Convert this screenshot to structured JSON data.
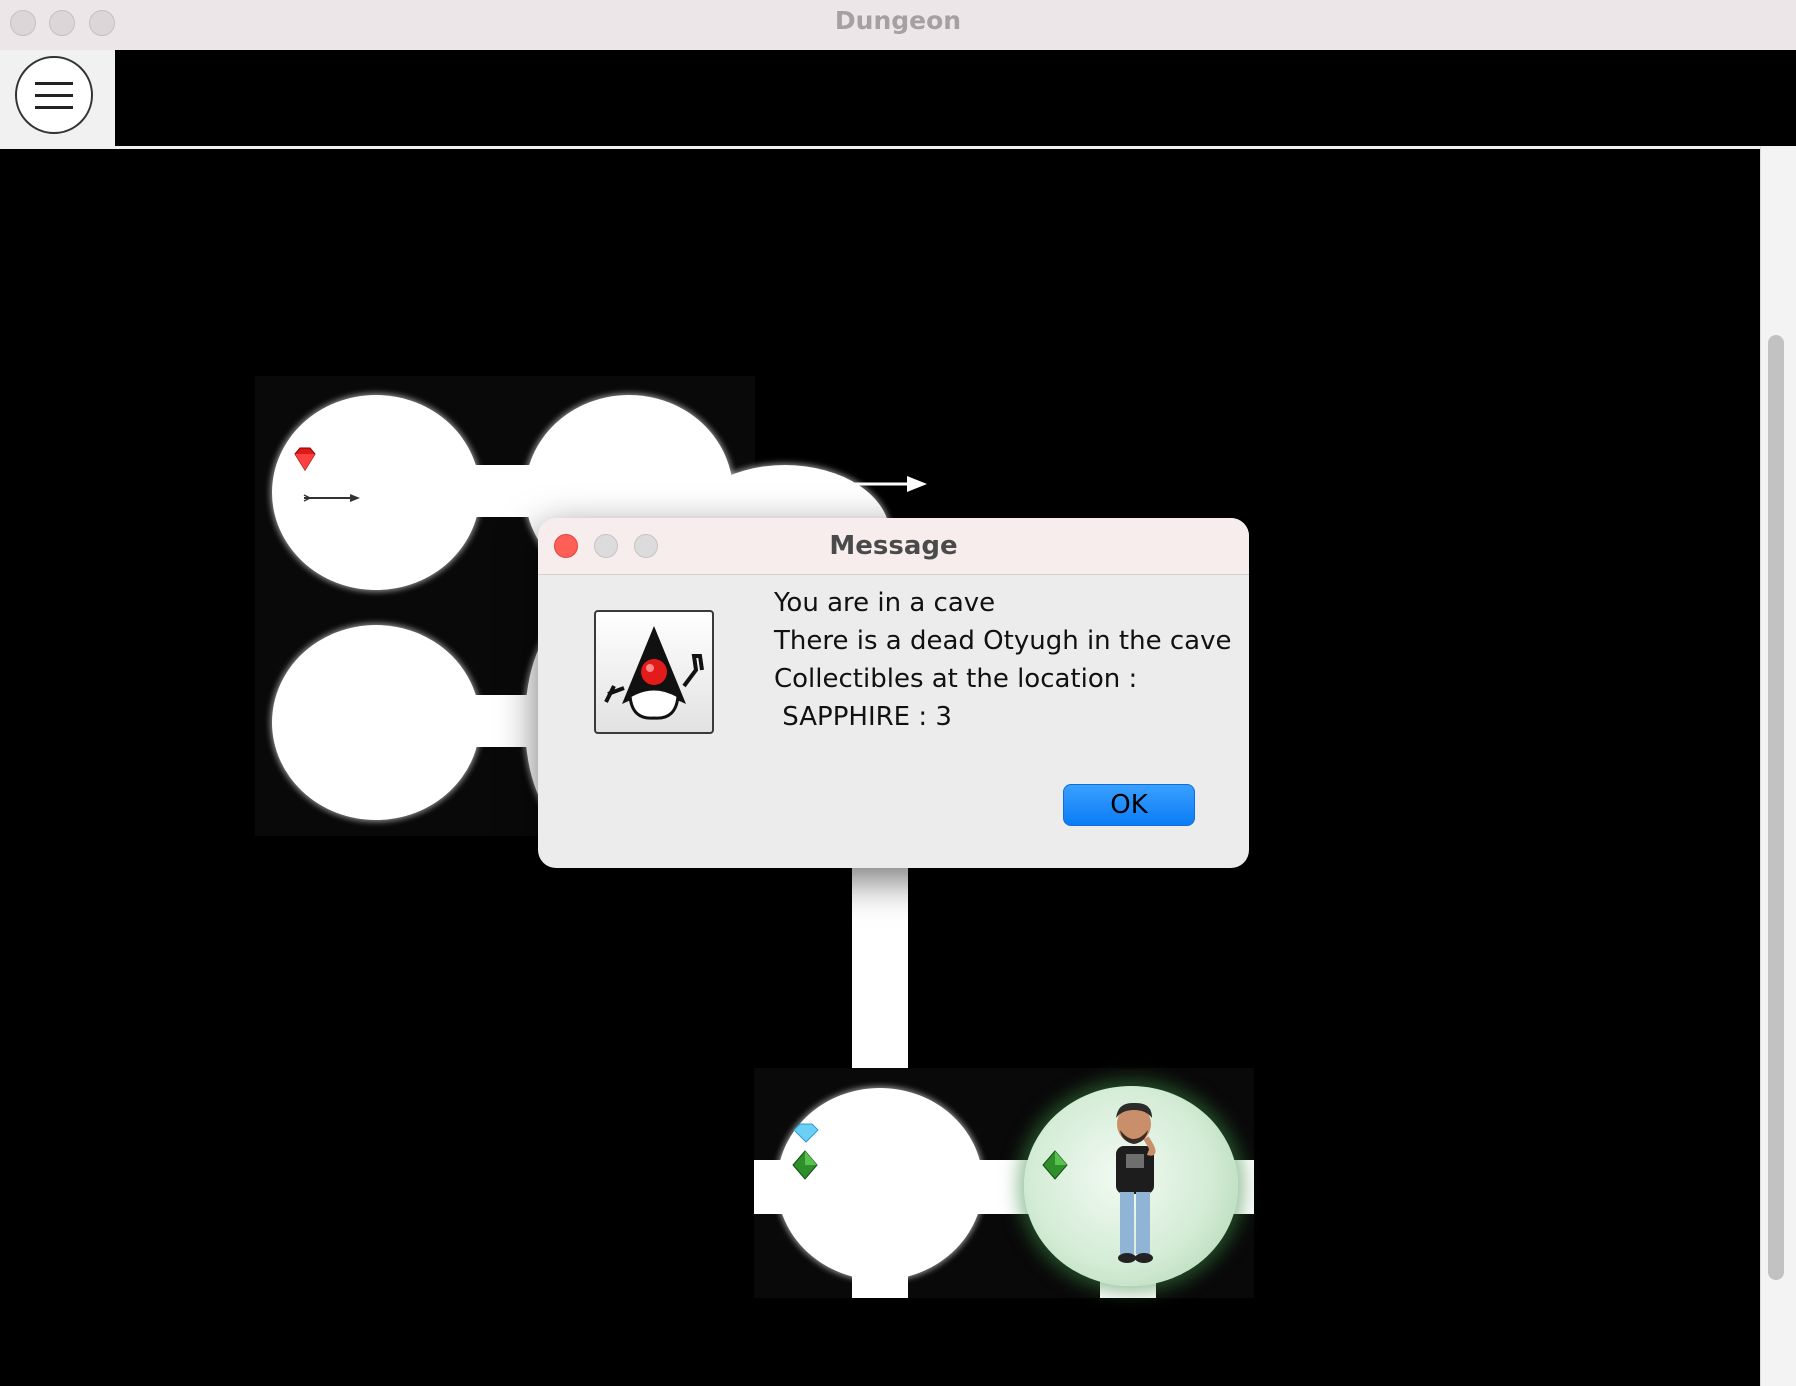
{
  "window": {
    "title": "Dungeon"
  },
  "toolbar": {
    "menu_icon": "hamburger-menu-icon"
  },
  "dungeon": {
    "player_icon": "player-avatar-icon",
    "items": [
      "ruby-icon",
      "arrow-icon",
      "diamond-icon",
      "emerald-icon"
    ]
  },
  "dialog": {
    "title": "Message",
    "icon": "java-duke-icon",
    "lines": [
      "You are in a cave",
      "There is a dead Otyugh in the cave",
      "Collectibles at the location :",
      " SAPPHIRE : 3"
    ],
    "ok_label": "OK"
  },
  "colors": {
    "titlebar": "#ece6e8",
    "dialog_bg": "#ececec",
    "ok_button": "#0a7cf5",
    "close_dot": "#fe5f57"
  }
}
